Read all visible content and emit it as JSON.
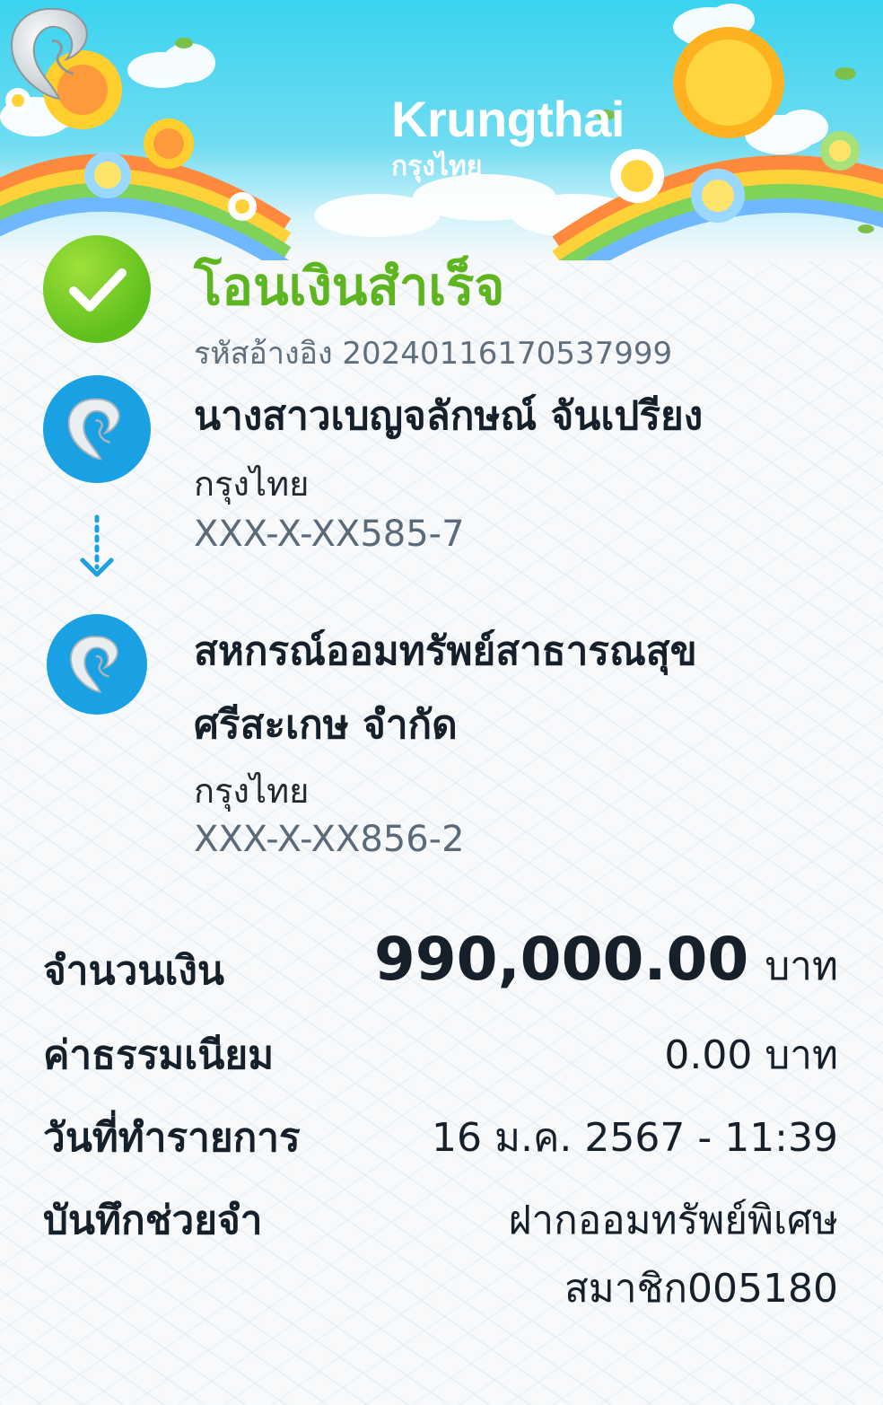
{
  "header": {
    "brand_en": "Krungthai",
    "brand_th": "กรุงไทย"
  },
  "status": {
    "title": "โอนเงินสำเร็จ",
    "reference_label": "รหัสอ้างอิง 2024011617053799​9"
  },
  "sender": {
    "name": "นางสาวเบญจลักษณ์ จันเปรียง",
    "bank": "กรุงไทย",
    "account": "XXX-X-XX585-7"
  },
  "receiver": {
    "name_line1": "สหกรณ์ออมทรัพย์สาธารณสุข",
    "name_line2": "ศรีสะเกษ จำกัด",
    "bank": "กรุงไทย",
    "account": "XXX-X-XX856-2"
  },
  "details": {
    "amount_label": "จำนวนเงิน",
    "amount_value": "990,000.00",
    "amount_unit": "บาท",
    "fee_label": "ค่าธรรมเนียม",
    "fee_value": "0.00 บาท",
    "date_label": "วันที่ทำรายการ",
    "date_value": "16 ม.ค. 2567 - 11:39",
    "memo_label": "บันทึกช่วยจำ",
    "memo_line1": "ฝากออมทรัพย์พิเศษ",
    "memo_line2": "สมาชิก005180"
  },
  "colors": {
    "success_green": "#5db61f",
    "brand_blue": "#1aa1e3",
    "sky": "#3ad3f0"
  },
  "icons": [
    "check-icon",
    "krungthai-bird-logo",
    "arrow-down-icon"
  ]
}
